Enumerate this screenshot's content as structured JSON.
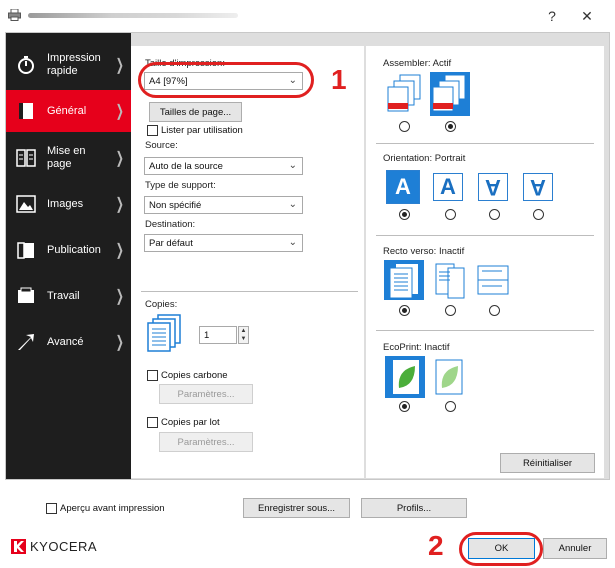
{
  "titlebar": {
    "help": "?",
    "close": "✕"
  },
  "sidebar": {
    "items": [
      {
        "label": "Impression\nrapide"
      },
      {
        "label": "Général"
      },
      {
        "label": "Mise en page"
      },
      {
        "label": "Images"
      },
      {
        "label": "Publication"
      },
      {
        "label": "Travail"
      },
      {
        "label": "Avancé"
      }
    ]
  },
  "general": {
    "print_size_label": "Taille d'impression:",
    "print_size_value": "A4  [97%]",
    "page_sizes_button": "Tailles de page...",
    "list_by_use": "Lister par utilisation",
    "source_label": "Source:",
    "source_value": "Auto de la source",
    "media_label": "Type de support:",
    "media_value": "Non spécifié",
    "destination_label": "Destination:",
    "destination_value": "Par défaut",
    "copies_label": "Copies:",
    "copies_value": "1",
    "carbon_copies": "Copies carbone",
    "params_button_1": "Paramètres...",
    "batch_copies": "Copies par lot",
    "params_button_2": "Paramètres..."
  },
  "right": {
    "collate_label": "Assembler: Actif",
    "orientation_label": "Orientation: Portrait",
    "duplex_label": "Recto verso: Inactif",
    "ecoprint_label": "EcoPrint: Inactif",
    "reset_button": "Réinitialiser",
    "orient_glyphs": [
      "A",
      "A",
      "A",
      "A"
    ]
  },
  "callouts": {
    "one": "1",
    "two": "2"
  },
  "footer": {
    "preview_label": "Aperçu avant impression",
    "save_as": "Enregistrer sous...",
    "profiles": "Profils...",
    "brand": "KYOCERA",
    "ok": "OK",
    "cancel": "Annuler"
  },
  "colors": {
    "accent": "#e6001b",
    "selected": "#1e7fd6",
    "callout": "#e02020"
  }
}
